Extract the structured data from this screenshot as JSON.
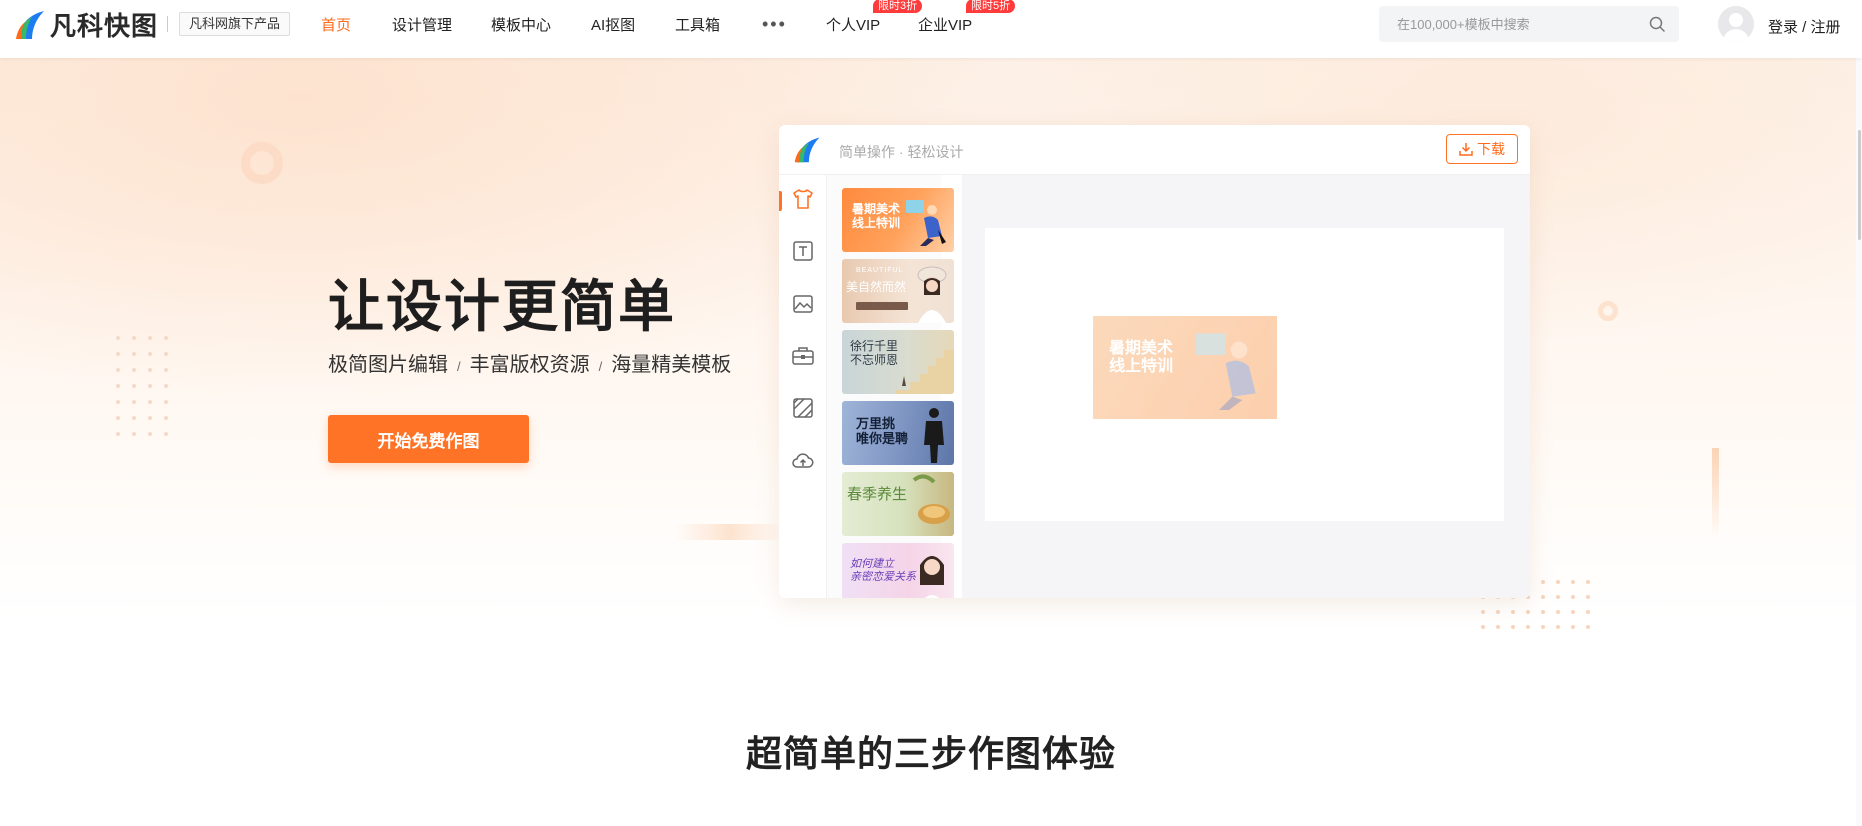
{
  "header": {
    "logo_text": "凡科快图",
    "brand_tag": "凡科网旗下产品",
    "nav": [
      {
        "label": "首页",
        "active": true
      },
      {
        "label": "设计管理"
      },
      {
        "label": "模板中心"
      },
      {
        "label": "AI抠图"
      },
      {
        "label": "工具箱"
      },
      {
        "label": "个人VIP",
        "badge": "限时3折"
      },
      {
        "label": "企业VIP",
        "badge": "限时5折"
      }
    ],
    "more_icon": "ellipsis-icon",
    "search_placeholder": "在100,000+模板中搜索",
    "login_label": "登录 / 注册"
  },
  "hero": {
    "headline": "让设计更简单",
    "features": [
      "极简图片编辑",
      "丰富版权资源",
      "海量精美模板"
    ],
    "separator": "/",
    "cta_label": "开始免费作图"
  },
  "editor_mock": {
    "slogan": "简单操作 · 轻松设计",
    "download_label": "下载",
    "tools": [
      "tshirt-icon",
      "text-icon",
      "image-icon",
      "toolbox-icon",
      "background-icon",
      "upload-cloud-icon"
    ],
    "templates": [
      {
        "text": "暑期美术\n线上特训"
      },
      {
        "text": "美自然而然",
        "sub": "BEAUTIFUL"
      },
      {
        "text": "徐行千里\n不忘师恩"
      },
      {
        "text": "万里挑\n唯你是聘"
      },
      {
        "text": "春季养生"
      },
      {
        "text": "如何建立\n亲密恋爱关系"
      }
    ],
    "canvas_text": "暑期美术\n线上特训"
  },
  "section": {
    "title": "超简单的三步作图体验"
  },
  "colors": {
    "accent": "#ff7326",
    "badge": "#ff3b3b"
  }
}
